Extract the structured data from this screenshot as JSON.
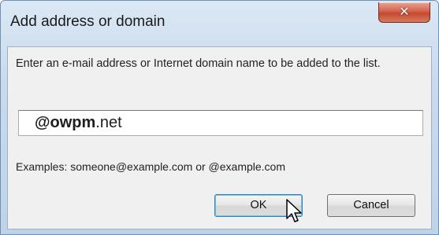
{
  "dialog": {
    "title": "Add address or domain",
    "close_icon": "close-icon",
    "prompt": "Enter an e-mail address or Internet domain name to be added to the list.",
    "field": {
      "value_bold": "@owpm",
      "value_rest": ".net"
    },
    "examples": "Examples: someone@example.com or @example.com",
    "ok_label": "OK",
    "cancel_label": "Cancel"
  },
  "colors": {
    "close_button": "#c44a30",
    "default_button_border": "#3c7fb1"
  }
}
